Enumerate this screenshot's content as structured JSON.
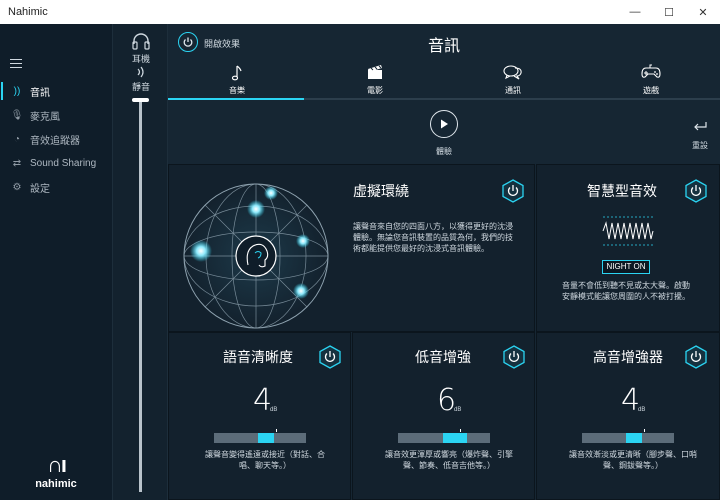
{
  "app": {
    "title": "Nahimic"
  },
  "window_controls": {
    "minimize": "—",
    "maximize": "☐",
    "close": "✕"
  },
  "nav": {
    "items": [
      {
        "label": "音訊",
        "icon": "audio-wave-icon",
        "active": true
      },
      {
        "label": "麥克風",
        "icon": "microphone-icon",
        "active": false
      },
      {
        "label": "音效追蹤器",
        "icon": "sound-tracker-icon",
        "active": false
      },
      {
        "label": "Sound Sharing",
        "icon": "sound-sharing-icon",
        "active": false
      },
      {
        "label": "設定",
        "icon": "gear-icon",
        "active": false
      }
    ],
    "logo_text": "nahimic"
  },
  "devices": {
    "output_label": "耳機",
    "mute_label": "靜音",
    "volume": 1.0
  },
  "header": {
    "effect_label": "開啟效果",
    "title": "音訊"
  },
  "tabs": [
    {
      "label": "音樂",
      "icon": "music-note-icon",
      "active": true
    },
    {
      "label": "電影",
      "icon": "clapperboard-icon",
      "active": false
    },
    {
      "label": "通訊",
      "icon": "chat-bubbles-icon",
      "active": false
    },
    {
      "label": "遊戲",
      "icon": "gamepad-icon",
      "active": false
    }
  ],
  "actions": {
    "play_label": "體驗",
    "reset_label": "重設"
  },
  "surround": {
    "title": "虛擬環繞",
    "desc_lines": [
      "讓聲音來自您的四面八方，以獲得更好的沈浸",
      "體驗。無論您音訊裝置的品質為何，我們的技",
      "術都能提供您最好的沈浸式音訊體驗。"
    ]
  },
  "smart_volume": {
    "title": "智慧型音效",
    "button": "NIGHT ON",
    "desc_lines": [
      "音量不會低到聽不見或太大聲。啟動",
      "安靜模式能讓您周圍的人不被打擾。"
    ]
  },
  "voice_clarity": {
    "title": "語音清晰度",
    "value": "4",
    "unit": "dB",
    "level": 0.57,
    "desc_lines": [
      "讓聲音變得遙遠或接近（對話、合",
      "唱、聊天等。）"
    ]
  },
  "bass_boost": {
    "title": "低音增強",
    "value": "6",
    "unit": "dB",
    "level": 0.62,
    "desc_lines": [
      "讓音效更渾厚或響亮（爆炸聲、引擎",
      "聲、節奏、低音吉他等。）"
    ]
  },
  "treble_boost": {
    "title": "高音增強器",
    "value": "4",
    "unit": "dB",
    "level": 0.57,
    "desc_lines": [
      "讓音效漸淡或更清晰（腳步聲、口哨",
      "聲、鋼鈸聲等。）"
    ]
  },
  "colors": {
    "accent": "#2bd4f2",
    "background": "#162633",
    "panel": "#13212d"
  }
}
